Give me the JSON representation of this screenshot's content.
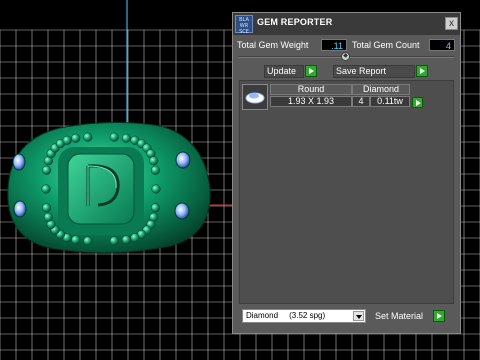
{
  "panel": {
    "logo_text": "BLA\nWR\nSCE",
    "title": "GEM REPORTER",
    "close_glyph": "x"
  },
  "stats": {
    "total_weight_label": "Total Gem Weight",
    "total_weight_value": ".11",
    "total_count_label": "Total Gem Count",
    "total_count_value": "4"
  },
  "toolbar": {
    "update_label": "Update",
    "save_report_label": "Save Report"
  },
  "gem_table": {
    "shape_header": "Round",
    "material_header": "Diamond",
    "size": "1.93 X 1.93",
    "count": "4",
    "weight": "0.11tw"
  },
  "material": {
    "selected": "Diamond     (3.52 spg)",
    "set_label": "Set Material"
  },
  "colors": {
    "ring_green": "#0e9e6b",
    "grid_line": "#bfbfbf",
    "axis_cyan": "#4fd1ff",
    "go_green": "#2faa2f"
  }
}
